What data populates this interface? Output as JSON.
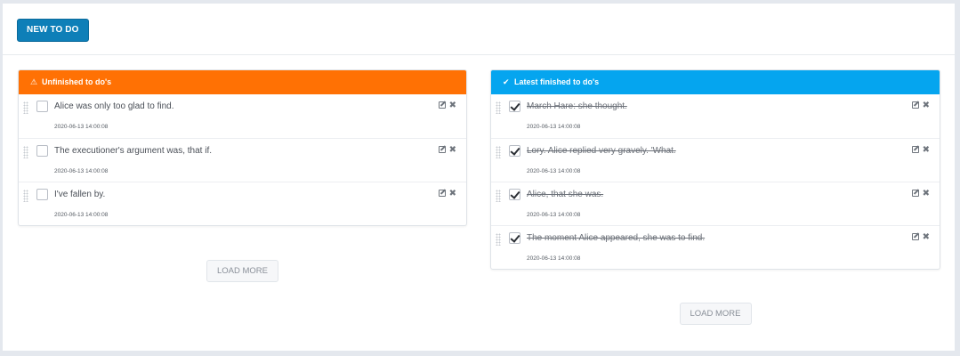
{
  "toolbar": {
    "new_label": "NEW TO DO"
  },
  "unfinished": {
    "title": "Unfinished to do's",
    "header_color": "#ff7104",
    "header_icon": "warning-icon",
    "items": [
      {
        "text": "Alice was only too glad to find.",
        "date": "2020-06-13 14:00:08",
        "checked": false
      },
      {
        "text": "The executioner's argument was, that if.",
        "date": "2020-06-13 14:00:08",
        "checked": false
      },
      {
        "text": "I've fallen by.",
        "date": "2020-06-13 14:00:08",
        "checked": false
      }
    ],
    "load_more": "LOAD MORE"
  },
  "finished": {
    "title": "Latest finished to do's",
    "header_color": "#05a5ef",
    "header_icon": "check-icon",
    "items": [
      {
        "text": "March Hare: she thought.",
        "date": "2020-06-13 14:00:08",
        "checked": true
      },
      {
        "text": "Lory. Alice replied very gravely. 'What.",
        "date": "2020-06-13 14:00:08",
        "checked": true
      },
      {
        "text": "Alice, that she was.",
        "date": "2020-06-13 14:00:08",
        "checked": true
      },
      {
        "text": "The moment Alice appeared, she was to find.",
        "date": "2020-06-13 14:00:08",
        "checked": true
      }
    ],
    "load_more": "LOAD MORE"
  }
}
